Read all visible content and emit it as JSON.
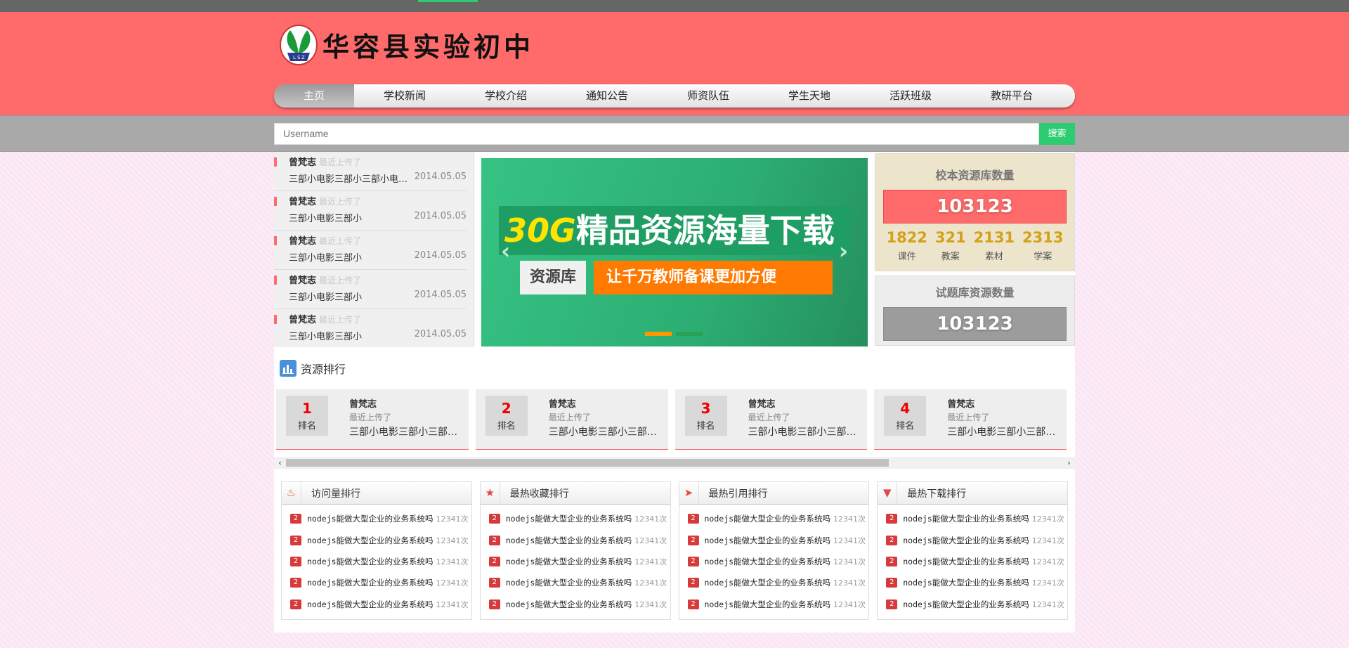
{
  "header": {
    "school_name": "华容县实验初中",
    "logo_initials": [
      "L",
      "S",
      "Z"
    ]
  },
  "nav": [
    {
      "label": "主页",
      "active": true
    },
    {
      "label": "学校新闻"
    },
    {
      "label": "学校介绍"
    },
    {
      "label": "通知公告"
    },
    {
      "label": "师资队伍"
    },
    {
      "label": "学生天地"
    },
    {
      "label": "活跃班级"
    },
    {
      "label": "教研平台"
    }
  ],
  "search": {
    "placeholder": "Username",
    "button_label": "搜索"
  },
  "news": [
    {
      "author": "曾梵志",
      "note": "最近上传了",
      "title": "三部小电影三部小三部小电影三部小三部小",
      "date": "2014.05.05"
    },
    {
      "author": "曾梵志",
      "note": "最近上传了",
      "title": "三部小电影三部小",
      "date": "2014.05.05"
    },
    {
      "author": "曾梵志",
      "note": "最近上传了",
      "title": "三部小电影三部小",
      "date": "2014.05.05"
    },
    {
      "author": "曾梵志",
      "note": "最近上传了",
      "title": "三部小电影三部小",
      "date": "2014.05.05"
    },
    {
      "author": "曾梵志",
      "note": "最近上传了",
      "title": "三部小电影三部小",
      "date": "2014.05.05"
    }
  ],
  "banner": {
    "headline_em": "30G",
    "headline": "精品资源海量下载",
    "tag": "资源库",
    "subline": "让千万教师备课更加方便",
    "dot_colors": [
      "#ff9800",
      "#2aa155"
    ]
  },
  "school_stats": {
    "title": "校本资源库数量",
    "total": "103123",
    "items": [
      {
        "value": "1822",
        "label": "课件"
      },
      {
        "value": "321",
        "label": "教案"
      },
      {
        "value": "2131",
        "label": "素材"
      },
      {
        "value": "2313",
        "label": "学案"
      }
    ]
  },
  "exam_stats": {
    "title": "试题库资源数量",
    "total": "103123"
  },
  "ranking": {
    "heading": "资源排行",
    "cards": [
      {
        "rank": "1",
        "rank_label": "排名",
        "author": "曾梵志",
        "note": "最近上传了",
        "title": "三部小电影三部小三部小电影三部小"
      },
      {
        "rank": "2",
        "rank_label": "排名",
        "author": "曾梵志",
        "note": "最近上传了",
        "title": "三部小电影三部小三部小电影三部小"
      },
      {
        "rank": "3",
        "rank_label": "排名",
        "author": "曾梵志",
        "note": "最近上传了",
        "title": "三部小电影三部小三部小电影三部小"
      },
      {
        "rank": "4",
        "rank_label": "排名",
        "author": "曾梵志",
        "note": "最近上传了",
        "title": "三部小电影三部小三部小电影三部小"
      }
    ]
  },
  "boards": [
    {
      "title": "访问量排行",
      "icon": "flame-icon",
      "icon_glyph": "♨",
      "items": [
        {
          "badge": "2",
          "text": "nodejs能做大型企业的业务系统吗",
          "count": "12341次"
        },
        {
          "badge": "2",
          "text": "nodejs能做大型企业的业务系统吗",
          "count": "12341次"
        },
        {
          "badge": "2",
          "text": "nodejs能做大型企业的业务系统吗",
          "count": "12341次"
        },
        {
          "badge": "2",
          "text": "nodejs能做大型企业的业务系统吗",
          "count": "12341次"
        },
        {
          "badge": "2",
          "text": "nodejs能做大型企业的业务系统吗",
          "count": "12341次"
        }
      ]
    },
    {
      "title": "最热收藏排行",
      "icon": "star-icon",
      "icon_glyph": "★",
      "items": [
        {
          "badge": "2",
          "text": "nodejs能做大型企业的业务系统吗",
          "count": "12341次"
        },
        {
          "badge": "2",
          "text": "nodejs能做大型企业的业务系统吗",
          "count": "12341次"
        },
        {
          "badge": "2",
          "text": "nodejs能做大型企业的业务系统吗",
          "count": "12341次"
        },
        {
          "badge": "2",
          "text": "nodejs能做大型企业的业务系统吗",
          "count": "12341次"
        },
        {
          "badge": "2",
          "text": "nodejs能做大型企业的业务系统吗",
          "count": "12341次"
        }
      ]
    },
    {
      "title": "最热引用排行",
      "icon": "paper-plane-icon",
      "icon_glyph": "➤",
      "items": [
        {
          "badge": "2",
          "text": "nodejs能做大型企业的业务系统吗",
          "count": "12341次"
        },
        {
          "badge": "2",
          "text": "nodejs能做大型企业的业务系统吗",
          "count": "12341次"
        },
        {
          "badge": "2",
          "text": "nodejs能做大型企业的业务系统吗",
          "count": "12341次"
        },
        {
          "badge": "2",
          "text": "nodejs能做大型企业的业务系统吗",
          "count": "12341次"
        },
        {
          "badge": "2",
          "text": "nodejs能做大型企业的业务系统吗",
          "count": "12341次"
        }
      ]
    },
    {
      "title": "最热下载排行",
      "icon": "download-icon",
      "icon_glyph": "▼",
      "items": [
        {
          "badge": "2",
          "text": "nodejs能做大型企业的业务系统吗",
          "count": "12341次"
        },
        {
          "badge": "2",
          "text": "nodejs能做大型企业的业务系统吗",
          "count": "12341次"
        },
        {
          "badge": "2",
          "text": "nodejs能做大型企业的业务系统吗",
          "count": "12341次"
        },
        {
          "badge": "2",
          "text": "nodejs能做大型企业的业务系统吗",
          "count": "12341次"
        },
        {
          "badge": "2",
          "text": "nodejs能做大型企业的业务系统吗",
          "count": "12341次"
        }
      ]
    }
  ],
  "colors": {
    "brand": "#ff6b6b",
    "accent": "#2ecc71",
    "gold": "#d4a017"
  }
}
